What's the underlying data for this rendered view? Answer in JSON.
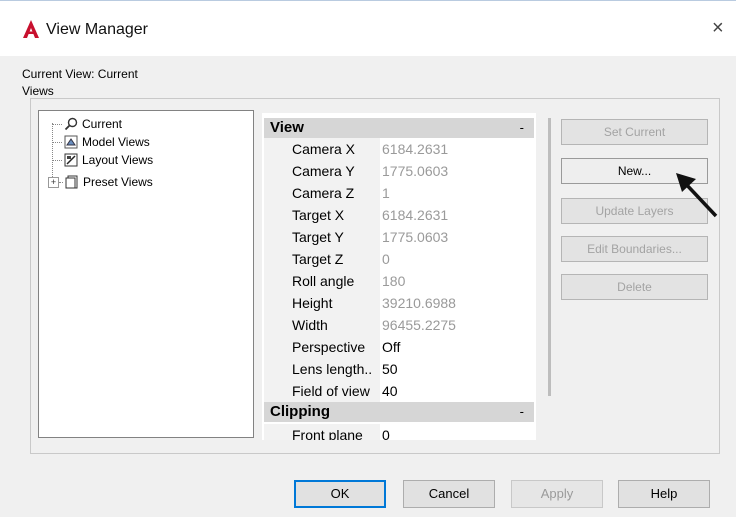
{
  "window": {
    "title": "View Manager",
    "close_glyph": "×",
    "logo_letter": "A",
    "logo_color": "#c8102e"
  },
  "current_view_label": "Current View: Current",
  "views_group_label": "Views",
  "tree": {
    "items": [
      {
        "label": "Current",
        "icon": "magnifier-icon"
      },
      {
        "label": "Model Views",
        "icon": "model-views-icon"
      },
      {
        "label": "Layout Views",
        "icon": "layout-views-icon"
      },
      {
        "label": "Preset Views",
        "icon": "preset-views-icon",
        "expander": "+"
      }
    ]
  },
  "properties": {
    "view_category": {
      "label": "View",
      "toggle": "-"
    },
    "view_rows": [
      {
        "label": "Camera X",
        "value": "6184.2631",
        "editable": false
      },
      {
        "label": "Camera Y",
        "value": "1775.0603",
        "editable": false
      },
      {
        "label": "Camera Z",
        "value": "1",
        "editable": false
      },
      {
        "label": "Target X",
        "value": "6184.2631",
        "editable": false
      },
      {
        "label": "Target Y",
        "value": "1775.0603",
        "editable": false
      },
      {
        "label": "Target Z",
        "value": "0",
        "editable": false
      },
      {
        "label": "Roll angle",
        "value": "180",
        "editable": false
      },
      {
        "label": "Height",
        "value": "39210.6988",
        "editable": false
      },
      {
        "label": "Width",
        "value": "96455.2275",
        "editable": false
      },
      {
        "label": "Perspective",
        "value": "Off",
        "editable": true
      },
      {
        "label": "Lens length..",
        "value": "50",
        "editable": true
      },
      {
        "label": "Field of view",
        "value": "40",
        "editable": true
      }
    ],
    "clipping_category": {
      "label": "Clipping",
      "toggle": "-"
    },
    "clipping_rows": [
      {
        "label": "Front plane",
        "value": "0",
        "editable": true
      }
    ]
  },
  "side_buttons": {
    "set_current": "Set Current",
    "new": "New...",
    "update_layers": "Update Layers",
    "edit_boundaries": "Edit Boundaries...",
    "delete": "Delete"
  },
  "bottom_buttons": {
    "ok": "OK",
    "cancel": "Cancel",
    "apply": "Apply",
    "help": "Help"
  }
}
